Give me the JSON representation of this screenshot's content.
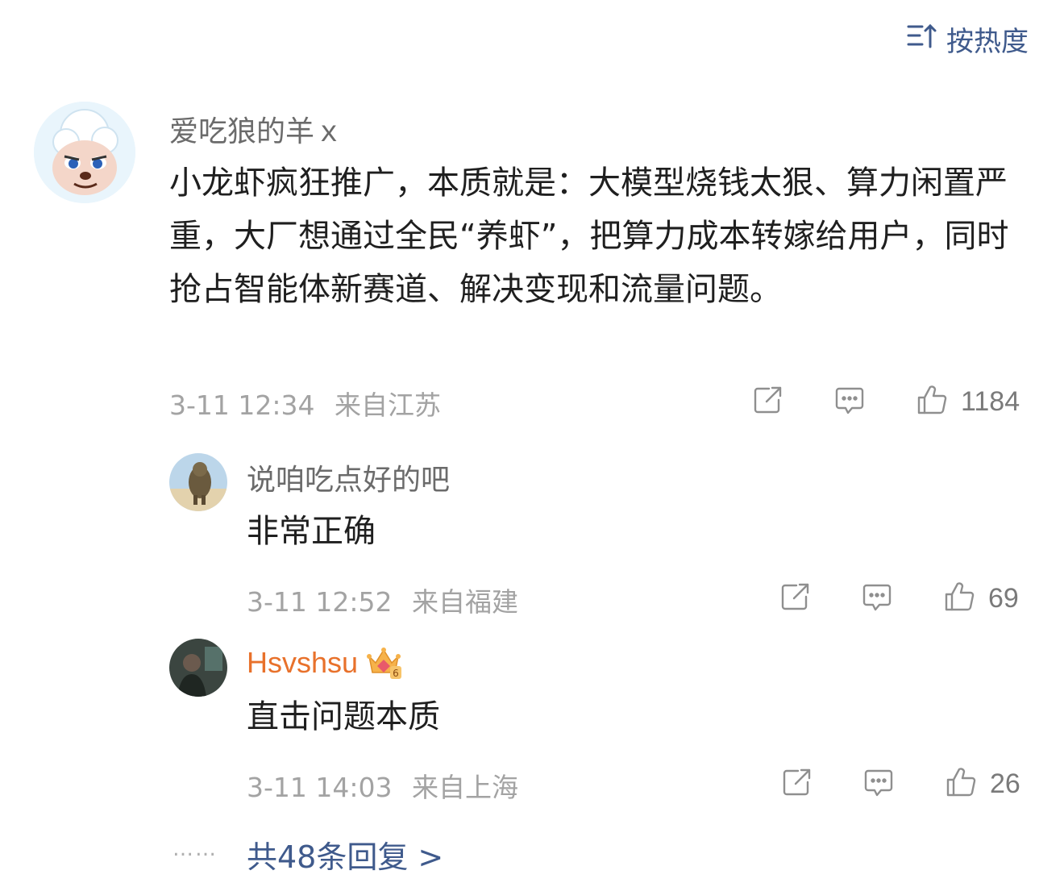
{
  "sort": {
    "label": "按热度",
    "icon": "sort-icon"
  },
  "main_comment": {
    "username": "爱吃狼的羊ｘ",
    "text": "小龙虾疯狂推广，本质就是：大模型烧钱太狠、算力闲置严重，大厂想通过全民“养虾”，把算力成本转嫁给用户，同时抢占智能体新赛道、解决变现和流量问题。",
    "time": "3-11 12:34",
    "location": "来自江苏",
    "likes": "1184"
  },
  "replies": [
    {
      "username": "说咱吃点好的吧",
      "text": "非常正确",
      "time": "3-11 12:52",
      "location": "来自福建",
      "likes": "69"
    },
    {
      "username": "Hsvshsu",
      "text": "直击问题本质",
      "time": "3-11 14:03",
      "location": "来自上海",
      "likes": "26",
      "badge": "crown-vip-6-icon",
      "name_color": "#e8712b"
    }
  ],
  "more": {
    "dots": "……",
    "label": "共48条回复 >"
  },
  "colors": {
    "link": "#3f5a8c",
    "vip_name": "#e8712b",
    "meta": "#a3a3a3"
  }
}
